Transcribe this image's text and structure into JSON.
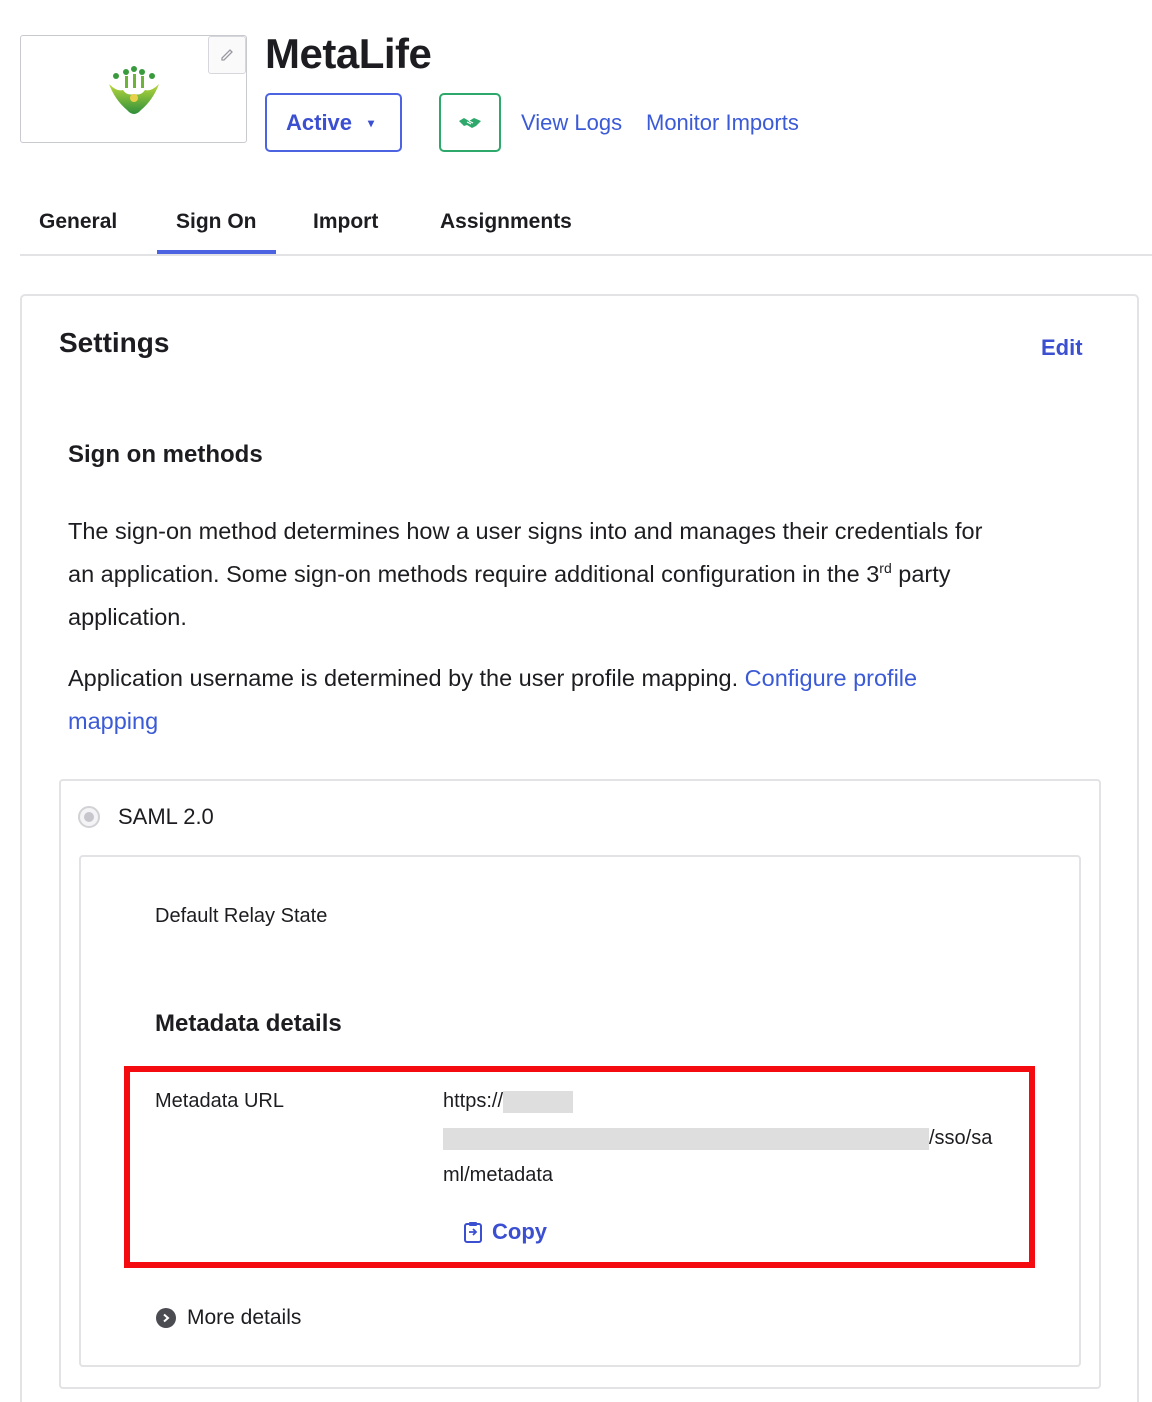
{
  "app": {
    "title": "MetaLife",
    "logo_icon": "metalife-logo",
    "edit_icon": "pencil-icon"
  },
  "header": {
    "status_label": "Active",
    "status_caret": "▾",
    "provisioning_icon": "handshake-icon",
    "view_logs": "View Logs",
    "monitor_imports": "Monitor Imports"
  },
  "tabs": [
    {
      "label": "General",
      "active": false
    },
    {
      "label": "Sign On",
      "active": true
    },
    {
      "label": "Import",
      "active": false
    },
    {
      "label": "Assignments",
      "active": false
    }
  ],
  "settings": {
    "title": "Settings",
    "edit_label": "Edit",
    "sign_on_heading": "Sign on methods",
    "desc_line1": "The sign-on method determines how a user signs into and manages their credentials for",
    "desc_line2_pre": "an application. Some sign-on methods require additional configuration in the 3",
    "desc_line2_sup": "rd",
    "desc_line2_post": " party",
    "desc_line3": "application.",
    "username_text": "Application username is determined by the user profile mapping.",
    "configure_link_part1": "Configure profile",
    "configure_link_part2": "mapping"
  },
  "saml": {
    "label": "SAML 2.0",
    "relay_state_label": "Default Relay State",
    "metadata_heading": "Metadata details",
    "metadata_url_label": "Metadata URL",
    "url_line1_prefix": "https://",
    "url_line2_suffix": "/sso/sa",
    "url_line3": "ml/metadata",
    "copy_label": "Copy",
    "copy_icon": "clipboard-icon",
    "more_details": "More details",
    "more_details_icon": "chevron-right-circle-icon"
  },
  "colors": {
    "accent": "#4c64e2",
    "link": "#3b5ad6",
    "highlight": "#f40b0f",
    "success": "#2ea86b"
  }
}
